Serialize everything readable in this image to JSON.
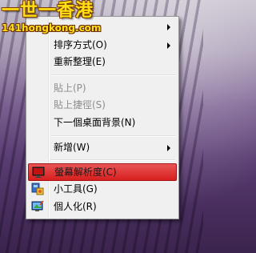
{
  "watermark": {
    "title": "一世一香港",
    "subtitle": "141hongkong.com"
  },
  "menu": {
    "items": [
      {
        "label": "排序方式(O)",
        "submenu": true,
        "enabled": true
      },
      {
        "label": "重新整理(E)",
        "submenu": false,
        "enabled": true
      },
      {
        "label": "貼上(P)",
        "submenu": false,
        "enabled": false
      },
      {
        "label": "貼上捷徑(S)",
        "submenu": false,
        "enabled": false
      },
      {
        "label": "下一個桌面背景(N)",
        "submenu": false,
        "enabled": true
      },
      {
        "label": "新增(W)",
        "submenu": true,
        "enabled": true
      },
      {
        "label": "螢幕解析度(C)",
        "submenu": false,
        "enabled": true,
        "highlighted": true,
        "icon": "display-icon"
      },
      {
        "label": "小工具(G)",
        "submenu": false,
        "enabled": true,
        "icon": "gadgets-icon"
      },
      {
        "label": "個人化(R)",
        "submenu": false,
        "enabled": true,
        "icon": "personalize-icon"
      }
    ]
  },
  "colors": {
    "highlight": "#d81e1e",
    "watermark_text": "#ffe014",
    "menu_bg": "#f0f0f0"
  }
}
